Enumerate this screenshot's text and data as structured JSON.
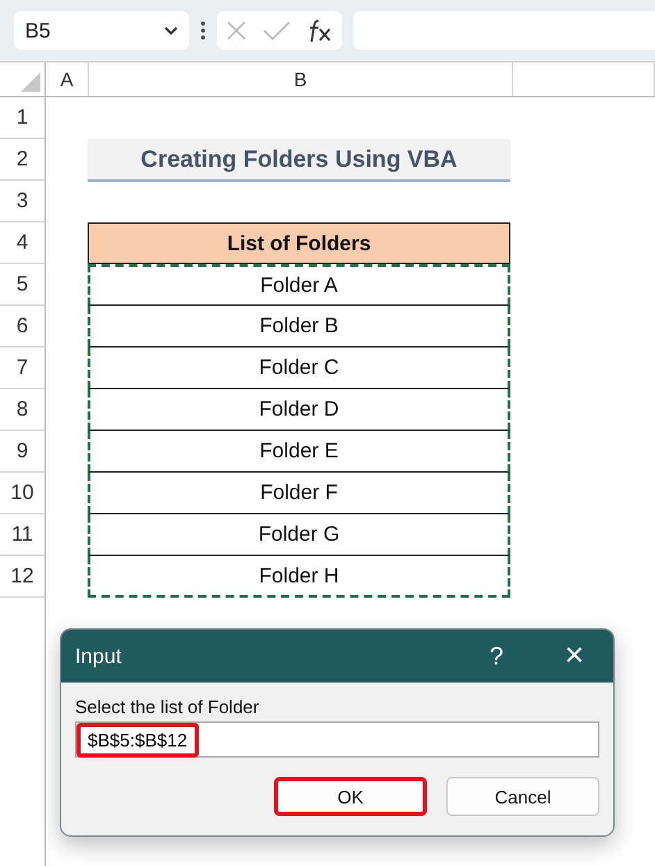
{
  "formula_bar": {
    "name_box": "B5"
  },
  "columns": [
    "A",
    "B"
  ],
  "rows": [
    "1",
    "2",
    "3",
    "4",
    "5",
    "6",
    "7",
    "8",
    "9",
    "10",
    "11",
    "12"
  ],
  "title": "Creating Folders Using VBA",
  "table": {
    "header": "List of Folders",
    "marquee": true,
    "items": [
      "Folder A",
      "Folder B",
      "Folder C",
      "Folder D",
      "Folder E",
      "Folder F",
      "Folder G",
      "Folder H"
    ]
  },
  "dialog": {
    "title": "Input",
    "help": "?",
    "close": "×",
    "prompt": "Select the list of Folder",
    "value": "$B$5:$B$12",
    "value_highlighted": true,
    "buttons": [
      {
        "label": "OK",
        "highlighted": true
      },
      {
        "label": "Cancel",
        "highlighted": false
      }
    ]
  }
}
